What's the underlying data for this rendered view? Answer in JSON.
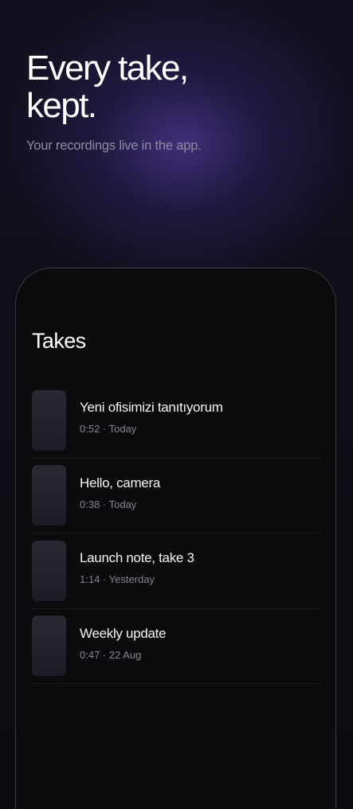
{
  "hero": {
    "title": "Every take,\nkept.",
    "subtitle": "Your recordings live in the app."
  },
  "screen": {
    "title": "Takes"
  },
  "takes": [
    {
      "name": "Yeni ofisimizi tanıtıyorum",
      "meta": "0:52 · Today"
    },
    {
      "name": "Hello, camera",
      "meta": "0:38 · Today"
    },
    {
      "name": "Launch note, take 3",
      "meta": "1:14 · Yesterday"
    },
    {
      "name": "Weekly update",
      "meta": "0:47 · 22 Aug"
    }
  ],
  "colors": {
    "background": "#0c0c10",
    "glow": "#48348a",
    "subtitle": "#8f8da3",
    "meta": "#86858f",
    "phone_border": "#3a3a40"
  }
}
